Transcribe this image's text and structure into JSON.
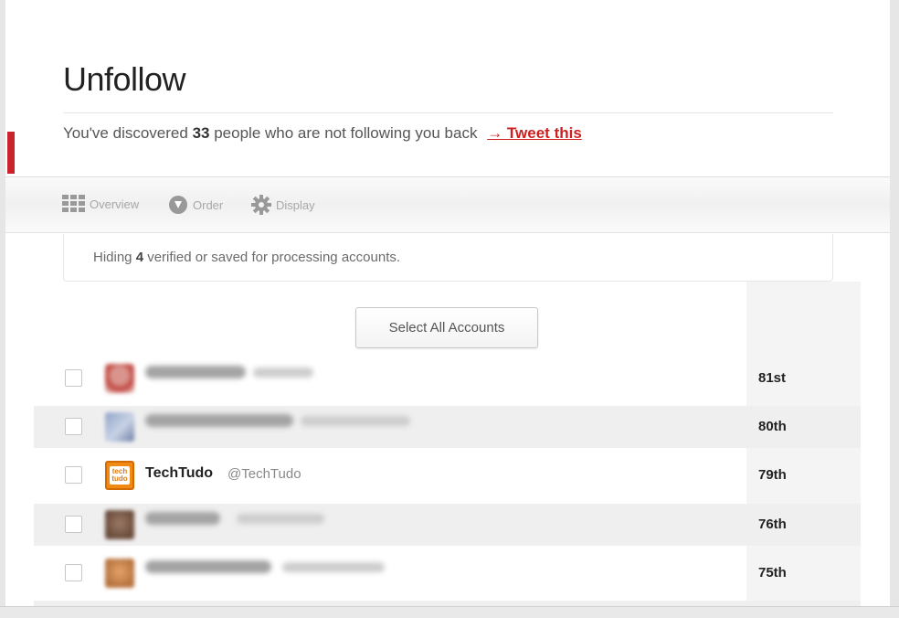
{
  "header": {
    "title": "Unfollow",
    "discover_prefix": "You've discovered",
    "discover_count": "33",
    "discover_suffix": "people who are not following you back",
    "tweet_link": "→ Tweet this"
  },
  "toolbar": {
    "items": [
      {
        "label": "Overview",
        "icon": "grid-icon"
      },
      {
        "label": "Order",
        "icon": "arrow-down-circle-icon"
      },
      {
        "label": "Display",
        "icon": "gear-icon"
      }
    ]
  },
  "notice": {
    "prefix": "Hiding",
    "count": "4",
    "suffix": "verified or saved for processing accounts."
  },
  "select_all_label": "Select All Accounts",
  "accounts": [
    {
      "name": "",
      "handle": "",
      "rank": "81st",
      "blurred": true
    },
    {
      "name": "",
      "handle": "",
      "rank": "80th",
      "blurred": true
    },
    {
      "name": "TechTudo",
      "handle": "@TechTudo",
      "rank": "79th",
      "blurred": false,
      "avatar_text": "tech tudo"
    },
    {
      "name": "",
      "handle": "",
      "rank": "76th",
      "blurred": true
    },
    {
      "name": "",
      "handle": "",
      "rank": "75th",
      "blurred": true
    }
  ],
  "colors": {
    "accent": "#c9242b",
    "link": "#cc1f1f",
    "techtudo_orange": "#f08a12"
  }
}
